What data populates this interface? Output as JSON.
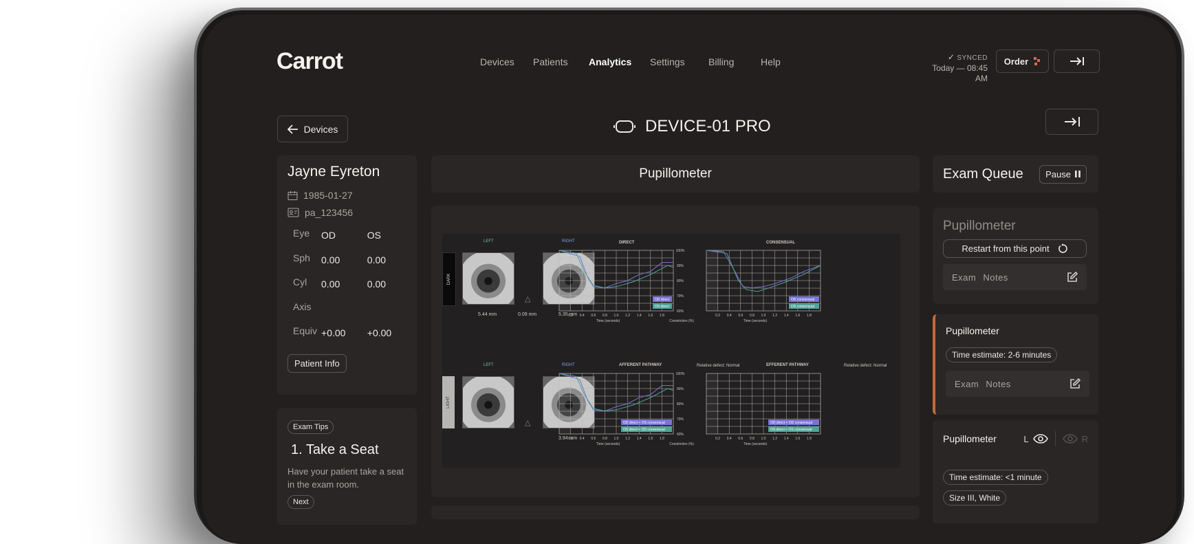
{
  "app": {
    "logo": "Carrot"
  },
  "nav": {
    "items": [
      {
        "label": "Devices"
      },
      {
        "label": "Patients"
      },
      {
        "label": "Analytics",
        "active": true
      },
      {
        "label": "Settings"
      },
      {
        "label": "Billing"
      },
      {
        "label": "Help"
      }
    ]
  },
  "sync": {
    "status": "SYNCED",
    "time": "Today — 08:45 AM"
  },
  "header": {
    "order_label": "Order",
    "back_label": "Devices",
    "device_title": "DEVICE-01 PRO"
  },
  "patient": {
    "name": "Jayne Eyreton",
    "dob": "1985-01-27",
    "id": "pa_123456",
    "rx": {
      "headers": {
        "label": "Eye",
        "od": "OD",
        "os": "OS"
      },
      "rows": [
        {
          "label": "Sph",
          "od": "0.00",
          "os": "0.00"
        },
        {
          "label": "Cyl",
          "od": "0.00",
          "os": "0.00"
        },
        {
          "label": "Axis",
          "od": "",
          "os": ""
        },
        {
          "label": "Equiv",
          "od": "+0.00",
          "os": "+0.00"
        }
      ]
    },
    "info_button": "Patient Info"
  },
  "tips": {
    "badge": "Exam Tips",
    "step_number": "1.",
    "title": "Take a Seat",
    "text": "Have your patient take a seat in the exam room.",
    "next_label": "Next"
  },
  "pupillometer": {
    "title": "Pupillometer",
    "results": {
      "dark": {
        "band_label": "DARK",
        "left_label": "LEFT",
        "right_label": "RIGHT",
        "left_mm": "5.44 mm",
        "delta_mm": "0.09 mm",
        "right_mm": "5.35 mm"
      },
      "light": {
        "band_label": "LIGHT",
        "left_label": "LEFT",
        "right_label": "RIGHT",
        "right_mm": "3.94 mm"
      },
      "charts": {
        "direct_title": "DIRECT",
        "consensual_title": "CONSENSUAL",
        "afferent_title": "AFFERENT PATHWAY",
        "efferent_title": "EFFERENT PATHWAY",
        "relative_defect": "Relative defect: Normal",
        "x_ticks": [
          "0.2",
          "0.4",
          "0.6",
          "0.8",
          "1.0",
          "1.2",
          "1.4",
          "1.6",
          "1.8"
        ],
        "y_ticks": [
          "100%",
          "90%",
          "80%",
          "70%",
          "60%"
        ],
        "x_label": "Time (seconds)",
        "y_label": "Constriction (%)",
        "legend": {
          "od_direct": "OD direct",
          "os_direct": "OS direct",
          "od_consensual": "OD consensual",
          "os_consensual": "OS consensual",
          "aff_a": "OD direct + OS consensual",
          "aff_b": "OS direct + OD consensual",
          "eff_a": "OD direct + OD consensual",
          "eff_b": "OS direct + OS consensual"
        },
        "colors": {
          "od": "#7b73d9",
          "os": "#4fa39a"
        }
      }
    }
  },
  "queue": {
    "title": "Exam Queue",
    "pause_label": "Pause",
    "items": [
      {
        "title": "Pupillometer",
        "restart_label": "Restart from this point",
        "notes_label": "Exam Notes"
      },
      {
        "title": "Pupillometer",
        "estimate": "Time estimate: 2-6 minutes",
        "notes_label": "Exam Notes",
        "accent": "#c86a3a"
      },
      {
        "title": "Pupillometer",
        "eye_left": "L",
        "eye_right": "R",
        "estimate": "Time estimate: <1 minute",
        "size": "Size III, White"
      }
    ]
  }
}
